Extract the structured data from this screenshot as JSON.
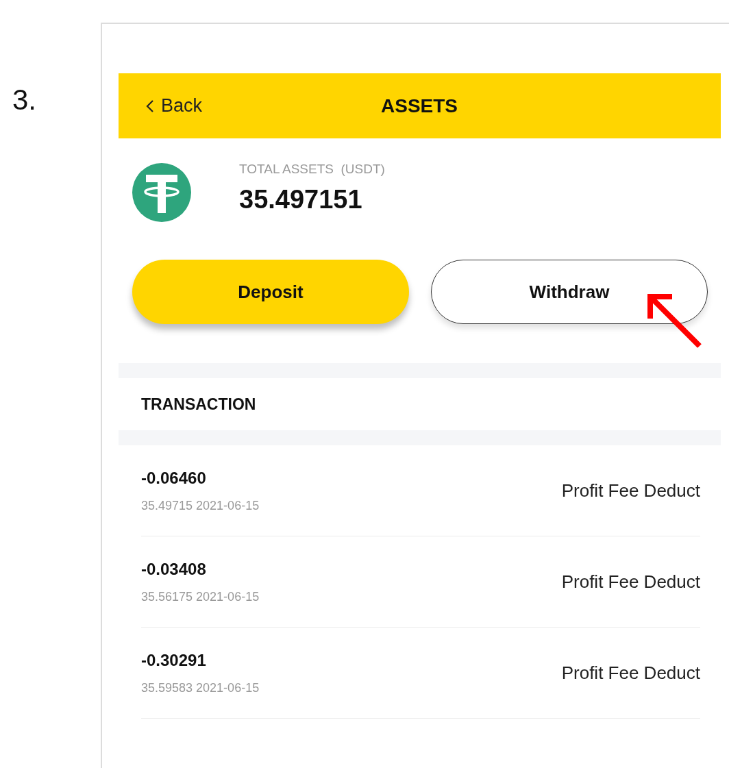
{
  "step_number": "3.",
  "header": {
    "back": "Back",
    "title": "ASSETS"
  },
  "balance": {
    "label": "TOTAL ASSETS  (USDT)",
    "amount": "35.497151"
  },
  "actions": [
    {
      "label": "Deposit",
      "kind": "primary",
      "highlighted": false
    },
    {
      "label": "Withdraw",
      "kind": "outline",
      "highlighted": true
    }
  ],
  "transactions": {
    "title": "TRANSACTION",
    "rows": [
      {
        "amount": "-0.06460",
        "detail": "35.49715 2021-06-15",
        "type": "Profit Fee Deduct"
      },
      {
        "amount": "-0.03408",
        "detail": "35.56175 2021-06-15",
        "type": "Profit Fee Deduct"
      },
      {
        "amount": "-0.30291",
        "detail": "35.59583 2021-06-15",
        "type": "Profit Fee Deduct"
      }
    ]
  }
}
